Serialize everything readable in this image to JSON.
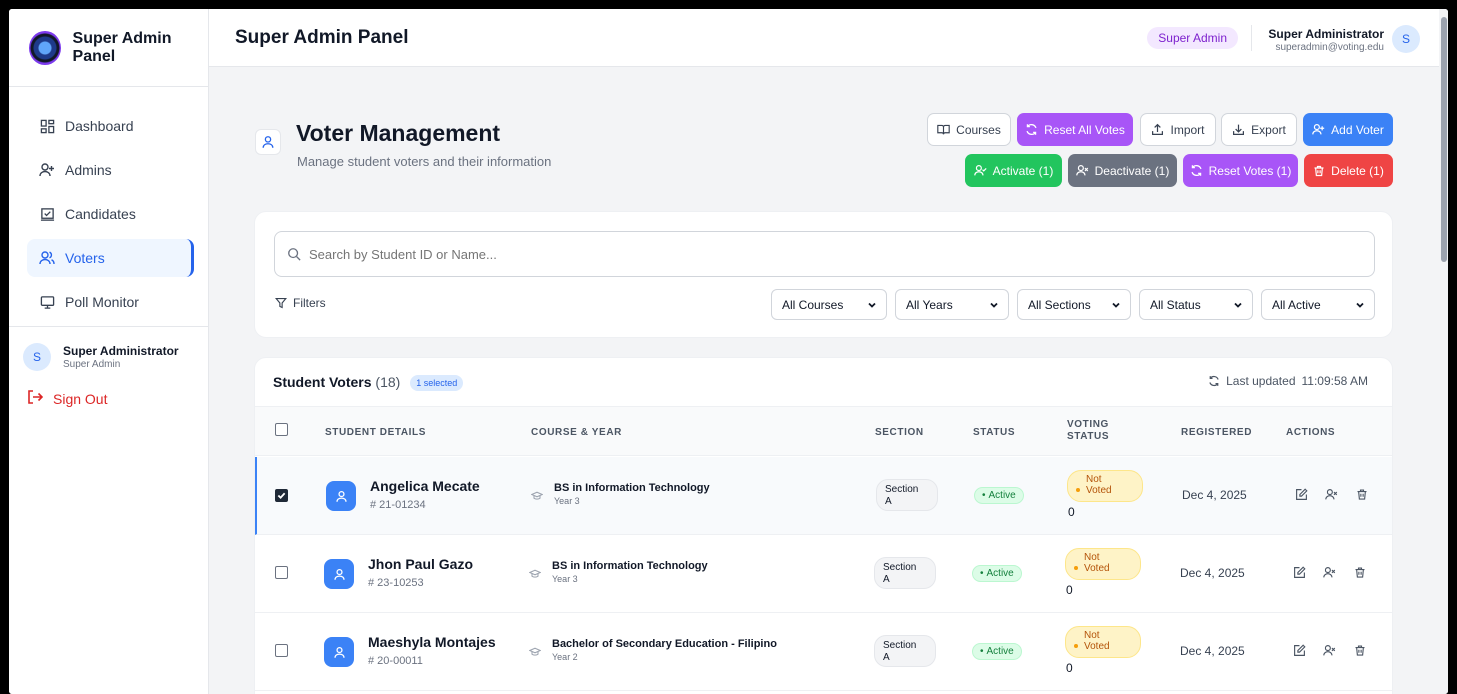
{
  "sidebar": {
    "brand": "Super Admin Panel",
    "items": [
      {
        "label": "Dashboard",
        "icon": "dashboard-icon"
      },
      {
        "label": "Admins",
        "icon": "user-plus-icon"
      },
      {
        "label": "Candidates",
        "icon": "ballot-icon"
      },
      {
        "label": "Voters",
        "icon": "users-icon",
        "active": true
      },
      {
        "label": "Poll Monitor",
        "icon": "monitor-icon"
      }
    ],
    "user": {
      "initial": "S",
      "name": "Super Administrator",
      "role": "Super Admin"
    },
    "signout": "Sign Out"
  },
  "header": {
    "title": "Super Admin Panel",
    "role_pill": "Super Admin",
    "user_name": "Super Administrator",
    "user_email": "superadmin@voting.edu",
    "user_initial": "S"
  },
  "page": {
    "title": "Voter Management",
    "subtitle": "Manage student voters and their information"
  },
  "toolbar": {
    "courses": "Courses",
    "reset_all": "Reset All Votes",
    "import": "Import",
    "export": "Export",
    "add_voter": "Add Voter",
    "activate": "Activate (1)",
    "deactivate": "Deactivate (1)",
    "reset_votes": "Reset Votes (1)",
    "delete": "Delete (1)"
  },
  "filters": {
    "search_placeholder": "Search by Student ID or Name...",
    "label": "Filters",
    "course": "All Courses",
    "year": "All Years",
    "section": "All Sections",
    "status": "All Status",
    "active": "All Active"
  },
  "table": {
    "title": "Student Voters",
    "count": "(18)",
    "selected": "1 selected",
    "last_updated_label": "Last updated",
    "last_updated_time": "11:09:58 AM",
    "headers": {
      "student": "Student Details",
      "course": "Course & Year",
      "section": "Section",
      "status": "Status",
      "voting_1": "Voting",
      "voting_2": "Status",
      "registered": "Registered",
      "actions": "Actions"
    },
    "rows": [
      {
        "name": "Angelica Mecate",
        "id": "# 21-01234",
        "course": "BS in Information Technology",
        "year": "Year 3",
        "section_1": "Section",
        "section_2": "A",
        "status": "Active",
        "vote_1": "Not",
        "vote_2": "Voted",
        "votes": "0",
        "registered": "Dec 4, 2025",
        "checked": true
      },
      {
        "name": "Jhon Paul Gazo",
        "id": "# 23-10253",
        "course": "BS in Information Technology",
        "year": "Year 3",
        "section_1": "Section",
        "section_2": "A",
        "status": "Active",
        "vote_1": "Not",
        "vote_2": "Voted",
        "votes": "0",
        "registered": "Dec 4, 2025",
        "checked": false
      },
      {
        "name": "Maeshyla Montajes",
        "id": "# 20-00011",
        "course": "Bachelor of Secondary Education - Filipino",
        "year": "Year 2",
        "section_1": "Section",
        "section_2": "A",
        "status": "Active",
        "vote_1": "Not",
        "vote_2": "Voted",
        "votes": "0",
        "registered": "Dec 4, 2025",
        "checked": false
      }
    ]
  },
  "colors": {
    "primary": "#3b82f6",
    "purple": "#a855f7",
    "green": "#22c55e",
    "gray": "#6b7280",
    "red": "#ef4444"
  }
}
